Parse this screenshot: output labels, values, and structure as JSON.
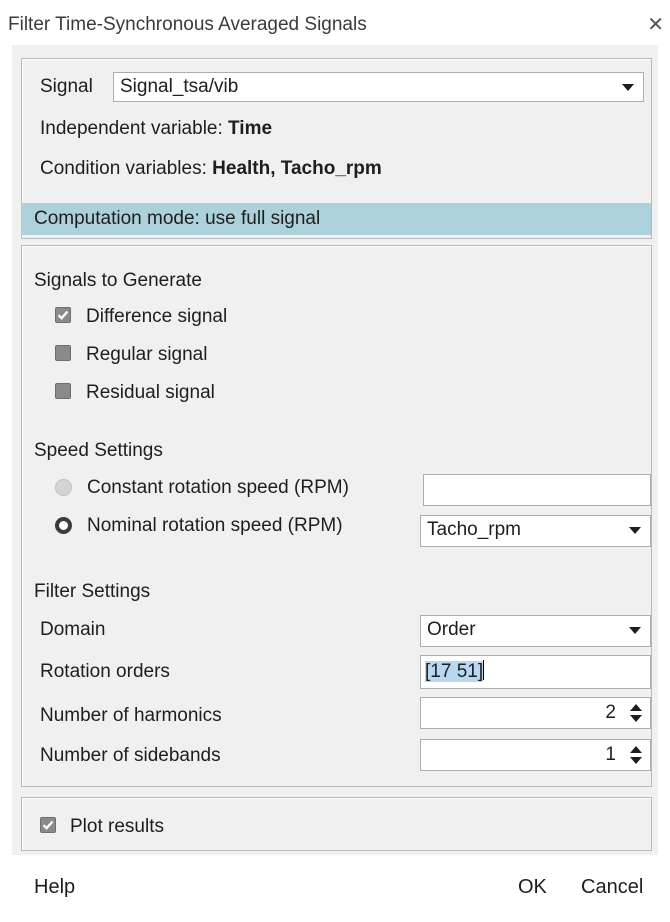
{
  "window": {
    "title": "Filter Time-Synchronous Averaged Signals",
    "close_glyph": "✕"
  },
  "signal_panel": {
    "signal_label": "Signal",
    "signal_value": "Signal_tsa/vib",
    "independent_label": "Independent variable:",
    "independent_value": "Time",
    "condition_label": "Condition variables:",
    "condition_value": "Health, Tacho_rpm",
    "computation_mode": "Computation mode: use full signal"
  },
  "signals_to_generate": {
    "heading": "Signals to Generate",
    "items": [
      {
        "label": "Difference signal",
        "checked": true
      },
      {
        "label": "Regular signal",
        "checked": false
      },
      {
        "label": "Residual signal",
        "checked": false
      }
    ]
  },
  "speed_settings": {
    "heading": "Speed Settings",
    "constant_label": "Constant rotation speed (RPM)",
    "constant_value": "",
    "nominal_label": "Nominal rotation speed (RPM)",
    "nominal_value": "Tacho_rpm",
    "selected": "nominal"
  },
  "filter_settings": {
    "heading": "Filter Settings",
    "domain_label": "Domain",
    "domain_value": "Order",
    "rotation_orders_label": "Rotation orders",
    "rotation_orders_value": "[17 51]",
    "harmonics_label": "Number of harmonics",
    "harmonics_value": "2",
    "sidebands_label": "Number of sidebands",
    "sidebands_value": "1"
  },
  "plot": {
    "label": "Plot results",
    "checked": true
  },
  "buttons": {
    "help": "Help",
    "ok": "OK",
    "cancel": "Cancel"
  },
  "colors": {
    "highlight": "#acd1da",
    "selection": "#b9d7f2",
    "panel_bg": "#f0f0f0"
  }
}
